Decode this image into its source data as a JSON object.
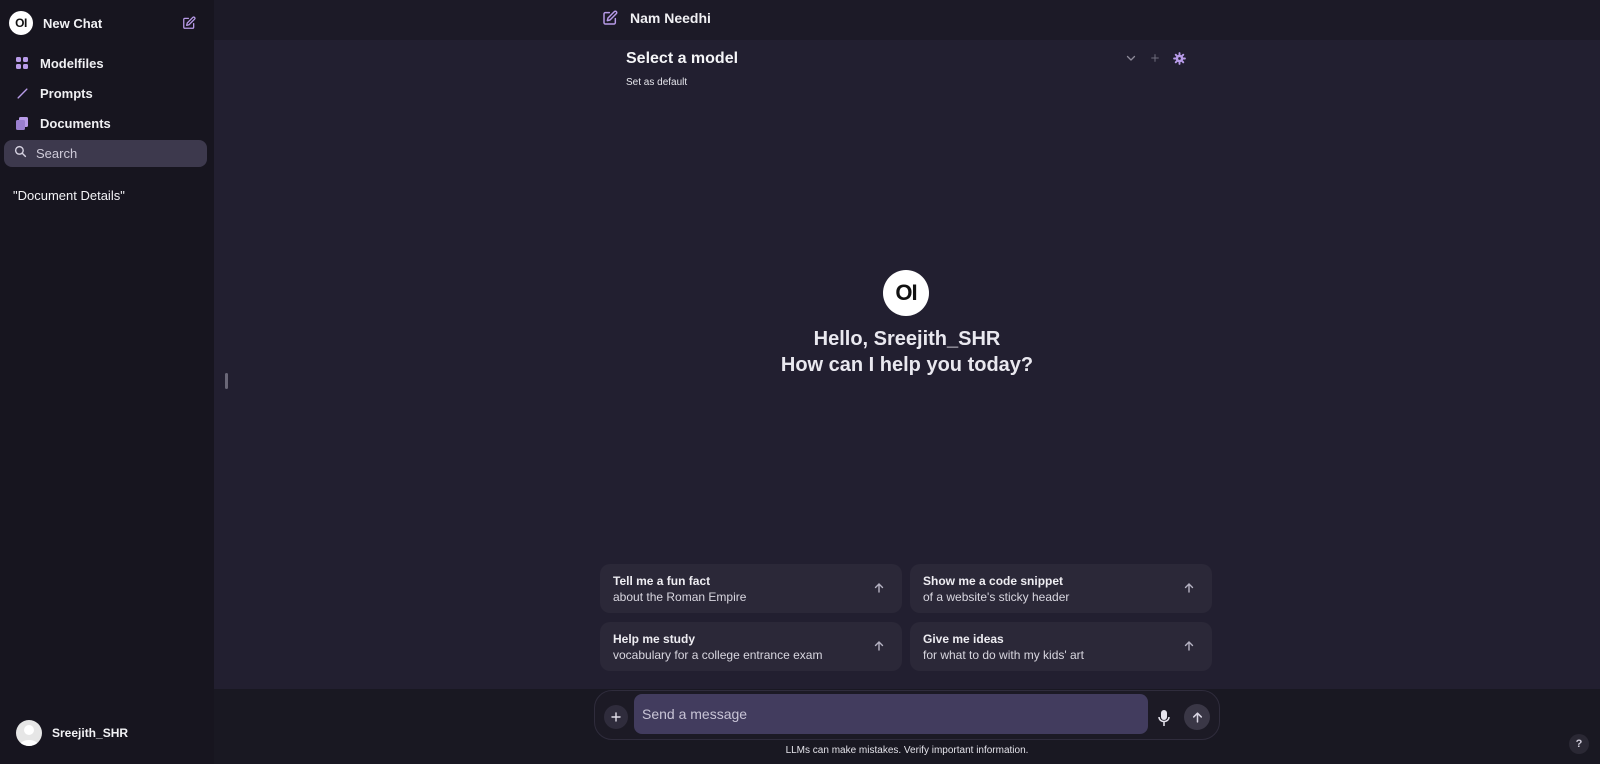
{
  "sidebar": {
    "logo_text": "OI",
    "new_chat_label": "New Chat",
    "nav": [
      {
        "label": "Modelfiles",
        "icon": "grid-icon"
      },
      {
        "label": "Prompts",
        "icon": "pencil-icon"
      },
      {
        "label": "Documents",
        "icon": "documents-icon"
      }
    ],
    "search_placeholder": "Search",
    "chats": [
      "\"Document Details\""
    ],
    "user_name": "Sreejith_SHR"
  },
  "header": {
    "title": "Nam Needhi"
  },
  "model_selector": {
    "title": "Select a model",
    "set_default_label": "Set as default"
  },
  "greeting": {
    "logo_text": "OI",
    "line1": "Hello, Sreejith_SHR",
    "line2": "How can I help you today?"
  },
  "suggestions": [
    {
      "title": "Tell me a fun fact",
      "subtitle": "about the Roman Empire"
    },
    {
      "title": "Show me a code snippet",
      "subtitle": "of a website's sticky header"
    },
    {
      "title": "Help me study",
      "subtitle": "vocabulary for a college entrance exam"
    },
    {
      "title": "Give me ideas",
      "subtitle": "for what to do with my kids' art"
    }
  ],
  "composer": {
    "placeholder": "Send a message",
    "disclaimer": "LLMs can make mistakes. Verify important information."
  },
  "help_label": "?",
  "colors": {
    "accent": "#b89be8",
    "sidebar_bg": "#17151f",
    "main_bg": "#221f30",
    "input_bg": "#423c5e"
  }
}
